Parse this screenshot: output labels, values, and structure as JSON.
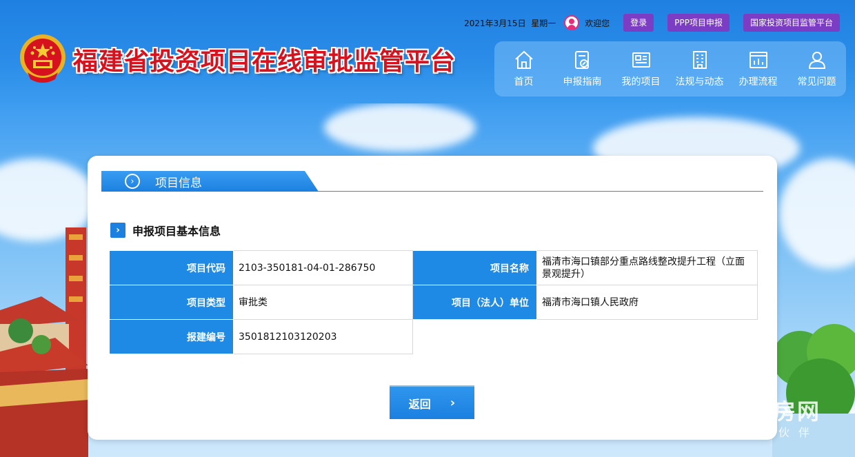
{
  "header": {
    "site_title": "福建省投资项目在线审批监管平台",
    "date": "2021年3月15日",
    "weekday": "星期一",
    "welcome": "欢迎您",
    "buttons": {
      "login": "登录",
      "ppp": "PPP项目申报",
      "national": "国家投资项目监管平台"
    },
    "nav": [
      {
        "label": "首页",
        "icon": "home-icon"
      },
      {
        "label": "申报指南",
        "icon": "guide-icon"
      },
      {
        "label": "我的项目",
        "icon": "project-icon"
      },
      {
        "label": "法规与动态",
        "icon": "building-icon"
      },
      {
        "label": "办理流程",
        "icon": "chart-icon"
      },
      {
        "label": "常见问题",
        "icon": "users-icon"
      }
    ]
  },
  "panel": {
    "tab": "项目信息",
    "section_title": "申报项目基本信息",
    "rows": [
      {
        "label1": "项目代码",
        "value1": "2103-350181-04-01-286750",
        "label2": "项目名称",
        "value2": "福清市海口镇部分重点路线整改提升工程（立面景观提升）"
      },
      {
        "label1": "项目类型",
        "value1": "审批类",
        "label2": "项目（法人）单位",
        "value2": "福清市海口镇人民政府"
      },
      {
        "label1": "报建编号",
        "value1": "3501812103120203"
      }
    ],
    "back_button": "返回"
  },
  "watermark": {
    "title": "福清好房网",
    "subtitle": "看福清合作伙伴"
  },
  "colors": {
    "primary_blue": "#1f8ae6",
    "purple": "#7b3dc4",
    "title_red": "#d6121f"
  }
}
